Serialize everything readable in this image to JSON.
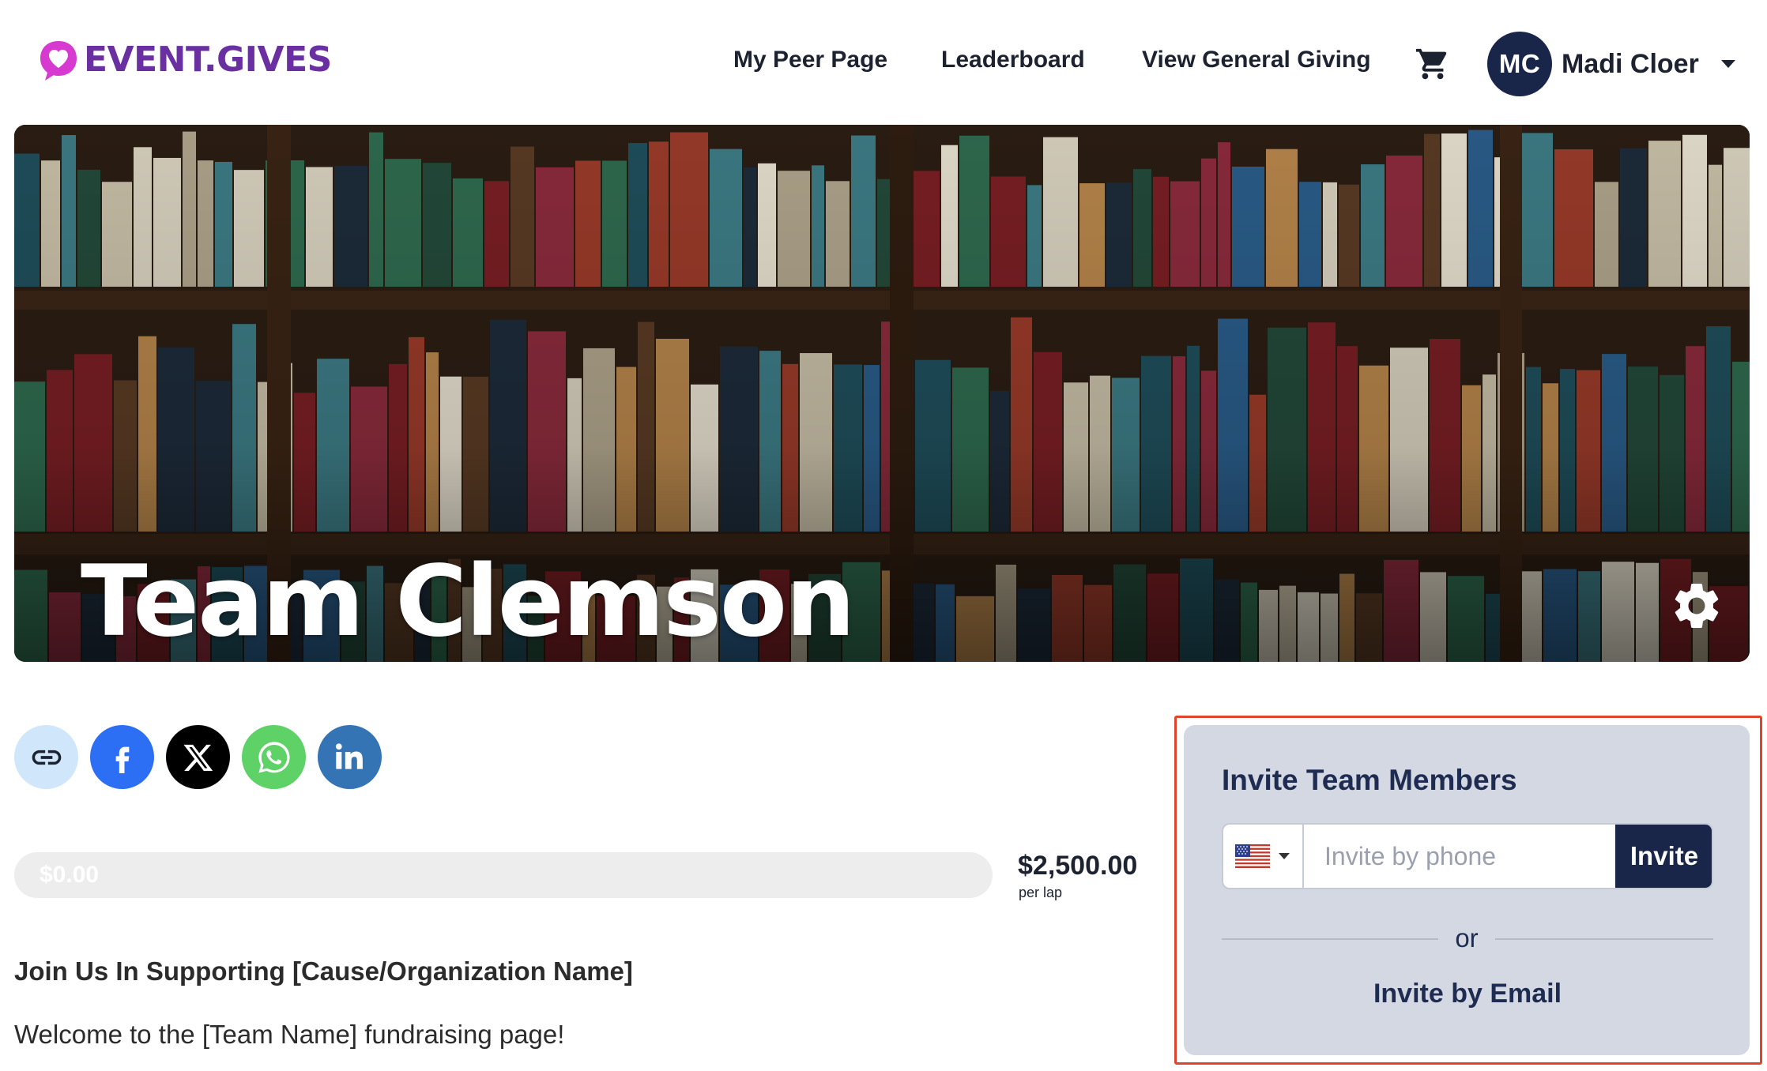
{
  "brand": {
    "name": "EVENT.GIVES",
    "color": "#6a2fa0",
    "mark_color": "#d63ad0"
  },
  "nav": {
    "links": [
      "My Peer Page",
      "Leaderboard",
      "View General Giving"
    ],
    "cart_icon": "shopping-cart-icon"
  },
  "user": {
    "initials": "MC",
    "name": "Madi Cloer",
    "menu_icon": "caret-down-icon"
  },
  "hero": {
    "title": "Team Clemson",
    "settings_icon": "gear-icon"
  },
  "share": {
    "buttons": [
      {
        "name": "copy-link",
        "icon": "link-icon",
        "color": "#cfe6fb"
      },
      {
        "name": "facebook",
        "icon": "facebook-icon",
        "color": "#2d6ff4"
      },
      {
        "name": "x",
        "icon": "x-logo-icon",
        "color": "#000000"
      },
      {
        "name": "whatsapp",
        "icon": "whatsapp-icon",
        "color": "#5ed167"
      },
      {
        "name": "linkedin",
        "icon": "linkedin-icon",
        "color": "#3474b4"
      }
    ]
  },
  "progress": {
    "raised": "$0.00",
    "raised_fraction": 0,
    "goal": "$2,500.00",
    "goal_unit": "per lap"
  },
  "content": {
    "heading": "Join Us In Supporting [Cause/Organization Name]",
    "body": "Welcome to the [Team Name] fundraising page!"
  },
  "invite": {
    "title": "Invite Team Members",
    "country_flag": "us-flag-icon",
    "phone_placeholder": "Invite by phone",
    "phone_value": "",
    "invite_button": "Invite",
    "divider_text": "or",
    "email_link": "Invite by Email"
  },
  "colors": {
    "navy": "#19264a",
    "highlight": "#e0452c",
    "panel": "#d4d8e2"
  }
}
